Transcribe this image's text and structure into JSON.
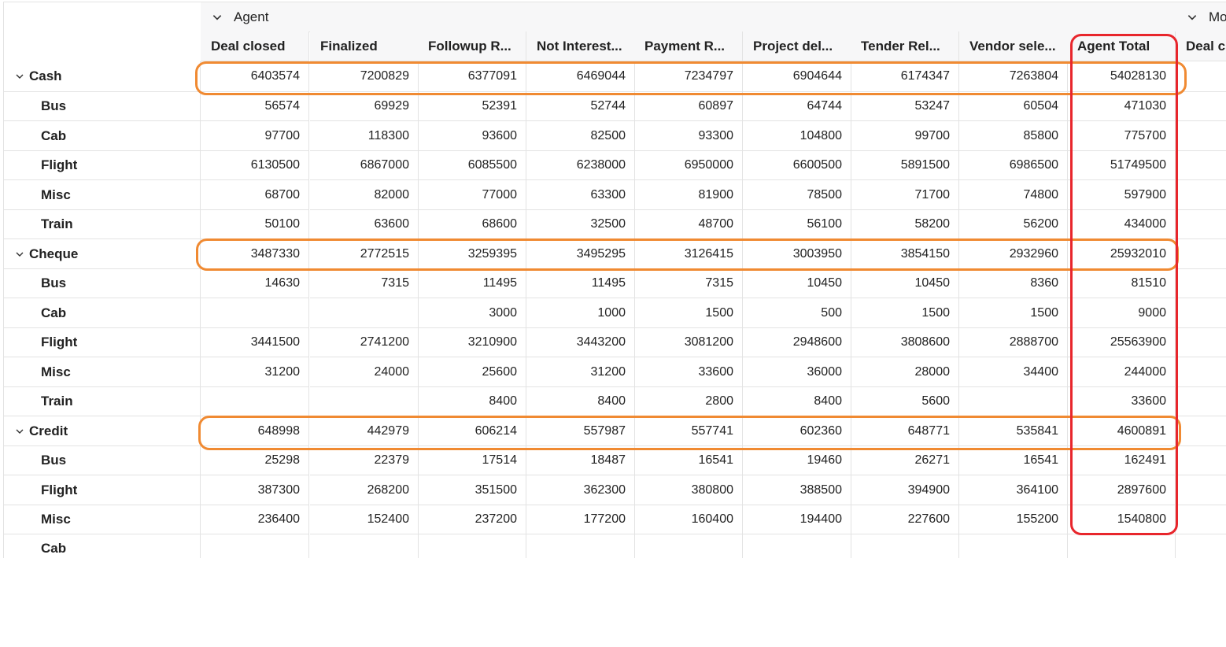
{
  "pivot": {
    "group_headers": [
      {
        "label": "Agent"
      },
      {
        "label": "Mo"
      }
    ],
    "columns": [
      "Deal closed",
      "Finalized",
      "Followup R...",
      "Not Interest...",
      "Payment R...",
      "Project del...",
      "Tender Rel...",
      "Vendor sele...",
      "Agent Total",
      "Deal cl"
    ],
    "rows": [
      {
        "label": "Cash",
        "type": "group",
        "values": [
          "6403574",
          "7200829",
          "6377091",
          "6469044",
          "7234797",
          "6904644",
          "6174347",
          "7263804",
          "54028130"
        ]
      },
      {
        "label": "Bus",
        "type": "child",
        "values": [
          "56574",
          "69929",
          "52391",
          "52744",
          "60897",
          "64744",
          "53247",
          "60504",
          "471030"
        ]
      },
      {
        "label": "Cab",
        "type": "child",
        "values": [
          "97700",
          "118300",
          "93600",
          "82500",
          "93300",
          "104800",
          "99700",
          "85800",
          "775700"
        ]
      },
      {
        "label": "Flight",
        "type": "child",
        "values": [
          "6130500",
          "6867000",
          "6085500",
          "6238000",
          "6950000",
          "6600500",
          "5891500",
          "6986500",
          "51749500"
        ]
      },
      {
        "label": "Misc",
        "type": "child",
        "values": [
          "68700",
          "82000",
          "77000",
          "63300",
          "81900",
          "78500",
          "71700",
          "74800",
          "597900"
        ]
      },
      {
        "label": "Train",
        "type": "child",
        "values": [
          "50100",
          "63600",
          "68600",
          "32500",
          "48700",
          "56100",
          "58200",
          "56200",
          "434000"
        ]
      },
      {
        "label": "Cheque",
        "type": "group",
        "values": [
          "3487330",
          "2772515",
          "3259395",
          "3495295",
          "3126415",
          "3003950",
          "3854150",
          "2932960",
          "25932010"
        ]
      },
      {
        "label": "Bus",
        "type": "child",
        "values": [
          "14630",
          "7315",
          "11495",
          "11495",
          "7315",
          "10450",
          "10450",
          "8360",
          "81510"
        ]
      },
      {
        "label": "Cab",
        "type": "child",
        "values": [
          "",
          "",
          "3000",
          "1000",
          "1500",
          "500",
          "1500",
          "1500",
          "9000"
        ]
      },
      {
        "label": "Flight",
        "type": "child",
        "values": [
          "3441500",
          "2741200",
          "3210900",
          "3443200",
          "3081200",
          "2948600",
          "3808600",
          "2888700",
          "25563900"
        ]
      },
      {
        "label": "Misc",
        "type": "child",
        "values": [
          "31200",
          "24000",
          "25600",
          "31200",
          "33600",
          "36000",
          "28000",
          "34400",
          "244000"
        ]
      },
      {
        "label": "Train",
        "type": "child",
        "values": [
          "",
          "",
          "8400",
          "8400",
          "2800",
          "8400",
          "5600",
          "",
          "33600"
        ]
      },
      {
        "label": "Credit",
        "type": "group",
        "values": [
          "648998",
          "442979",
          "606214",
          "557987",
          "557741",
          "602360",
          "648771",
          "535841",
          "4600891"
        ]
      },
      {
        "label": "Bus",
        "type": "child",
        "values": [
          "25298",
          "22379",
          "17514",
          "18487",
          "16541",
          "19460",
          "26271",
          "16541",
          "162491"
        ]
      },
      {
        "label": "Flight",
        "type": "child",
        "values": [
          "387300",
          "268200",
          "351500",
          "362300",
          "380800",
          "388500",
          "394900",
          "364100",
          "2897600"
        ]
      },
      {
        "label": "Misc",
        "type": "child",
        "values": [
          "236400",
          "152400",
          "237200",
          "177200",
          "160400",
          "194400",
          "227600",
          "155200",
          "1540800"
        ]
      },
      {
        "label": "Cab",
        "type": "child",
        "values": [
          "",
          "",
          "",
          "",
          "",
          "",
          "",
          "",
          ""
        ]
      }
    ]
  },
  "icons": {
    "expand": "chevron-down-icon"
  },
  "colors": {
    "highlight_row": "#f08a32",
    "highlight_column": "#e8262c",
    "header_bg": "#f7f7f8",
    "grid_line": "#e3e3e3"
  }
}
